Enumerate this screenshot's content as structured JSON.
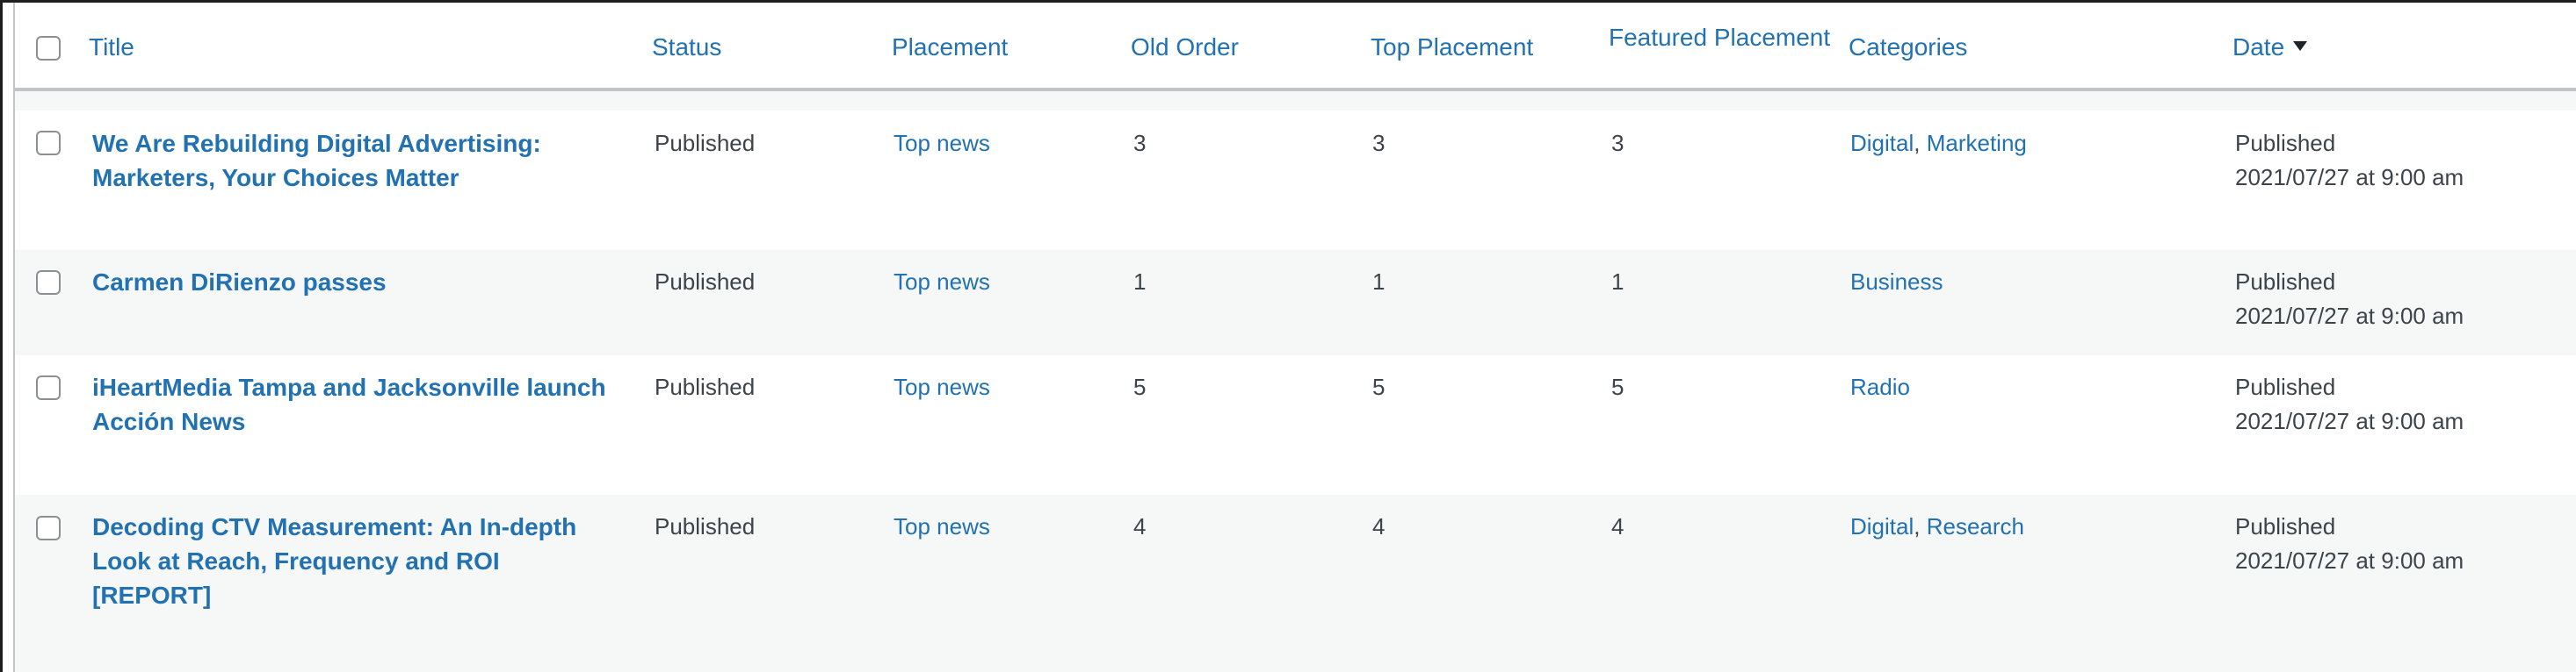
{
  "table": {
    "columns": {
      "title": "Title",
      "status": "Status",
      "placement": "Placement",
      "old_order": "Old Order",
      "top_placement": "Top Placement",
      "featured_placement": "Featured Placement",
      "categories": "Categories",
      "date": "Date"
    },
    "sorted_column": "date",
    "sort_direction": "descending",
    "rows": [
      {
        "title_line1": "We Are Rebuilding Digital Advertising:",
        "title_line2": "Marketers, Your Choices Matter",
        "title_line3": "",
        "status": "Published",
        "placement": "Top news",
        "old_order": "3",
        "top_placement": "3",
        "featured_placement": "3",
        "categories": [
          "Digital",
          "Marketing"
        ],
        "date_status": "Published",
        "date_value": "2021/07/27 at 9:00 am"
      },
      {
        "title_line1": "Carmen DiRienzo passes",
        "title_line2": "",
        "title_line3": "",
        "status": "Published",
        "placement": "Top news",
        "old_order": "1",
        "top_placement": "1",
        "featured_placement": "1",
        "categories": [
          "Business"
        ],
        "date_status": "Published",
        "date_value": "2021/07/27 at 9:00 am"
      },
      {
        "title_line1": "iHeartMedia Tampa and Jacksonville launch",
        "title_line2": "Acción News",
        "title_line3": "",
        "status": "Published",
        "placement": "Top news",
        "old_order": "5",
        "top_placement": "5",
        "featured_placement": "5",
        "categories": [
          "Radio"
        ],
        "date_status": "Published",
        "date_value": "2021/07/27 at 9:00 am"
      },
      {
        "title_line1": "Decoding CTV Measurement: An In-depth",
        "title_line2": "Look at Reach, Frequency and ROI",
        "title_line3": "[REPORT]",
        "status": "Published",
        "placement": "Top news",
        "old_order": "4",
        "top_placement": "4",
        "featured_placement": "4",
        "categories": [
          "Digital",
          "Research"
        ],
        "date_status": "Published",
        "date_value": "2021/07/27 at 9:00 am"
      }
    ]
  },
  "colors": {
    "link": "#2271b1",
    "text": "#3c434a",
    "row_alt": "#f6f7f7",
    "border": "#c3c4c7"
  }
}
